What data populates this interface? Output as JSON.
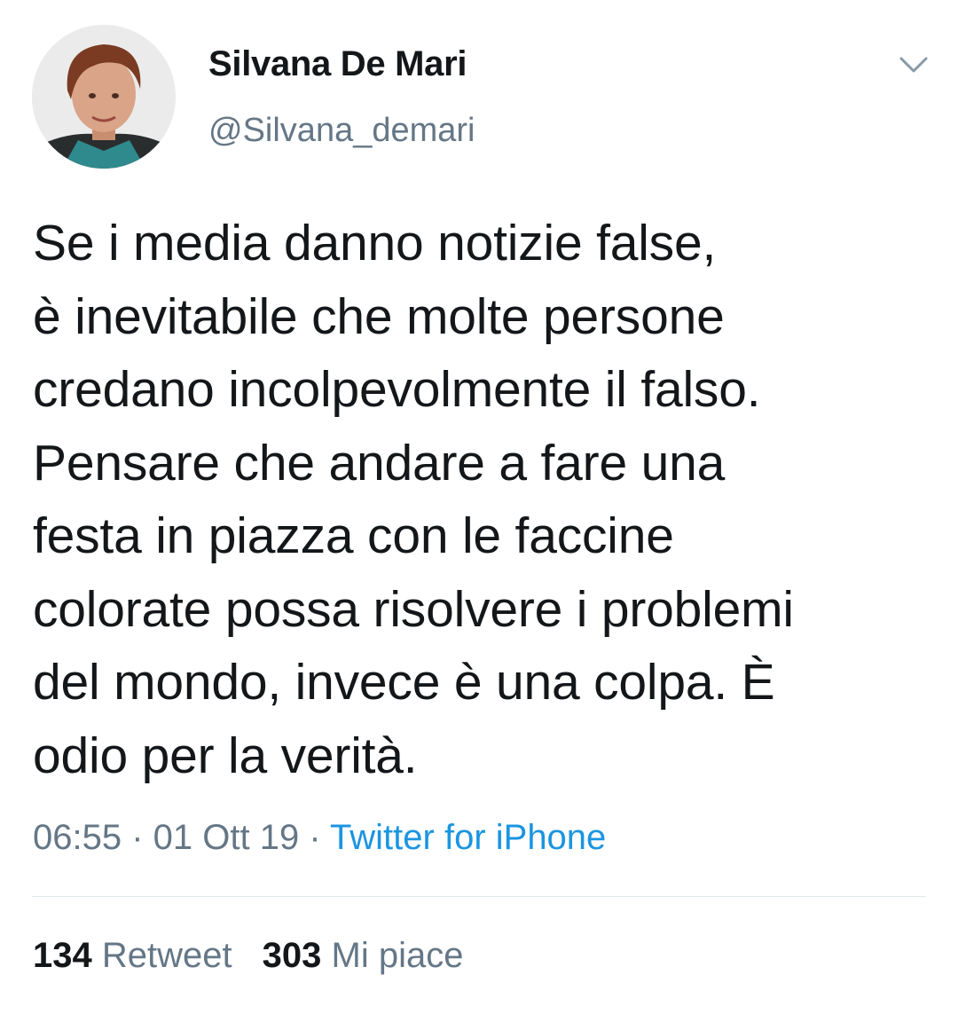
{
  "user": {
    "display_name": "Silvana De Mari",
    "handle": "@Silvana_demari"
  },
  "tweet": {
    "lines": [
      "Se i media danno notizie false,",
      "è inevitabile che molte persone",
      "credano incolpevolmente il falso.",
      "Pensare che andare a fare una",
      "festa in piazza con le faccine",
      "colorate possa risolvere i problemi",
      "del mondo, invece è una colpa. È",
      "odio per la verità."
    ]
  },
  "meta": {
    "time": "06:55",
    "separator": " · ",
    "date": "01 Ott 19",
    "source": "Twitter for iPhone"
  },
  "stats": {
    "retweets_count": "134",
    "retweets_label": "Retweet",
    "likes_count": "303",
    "likes_label": "Mi piace"
  },
  "icons": {
    "menu": "chevron-down-icon"
  },
  "colors": {
    "text": "#14171a",
    "secondary": "#657786",
    "link": "#1b95e0",
    "divider": "#e1e8ed"
  }
}
